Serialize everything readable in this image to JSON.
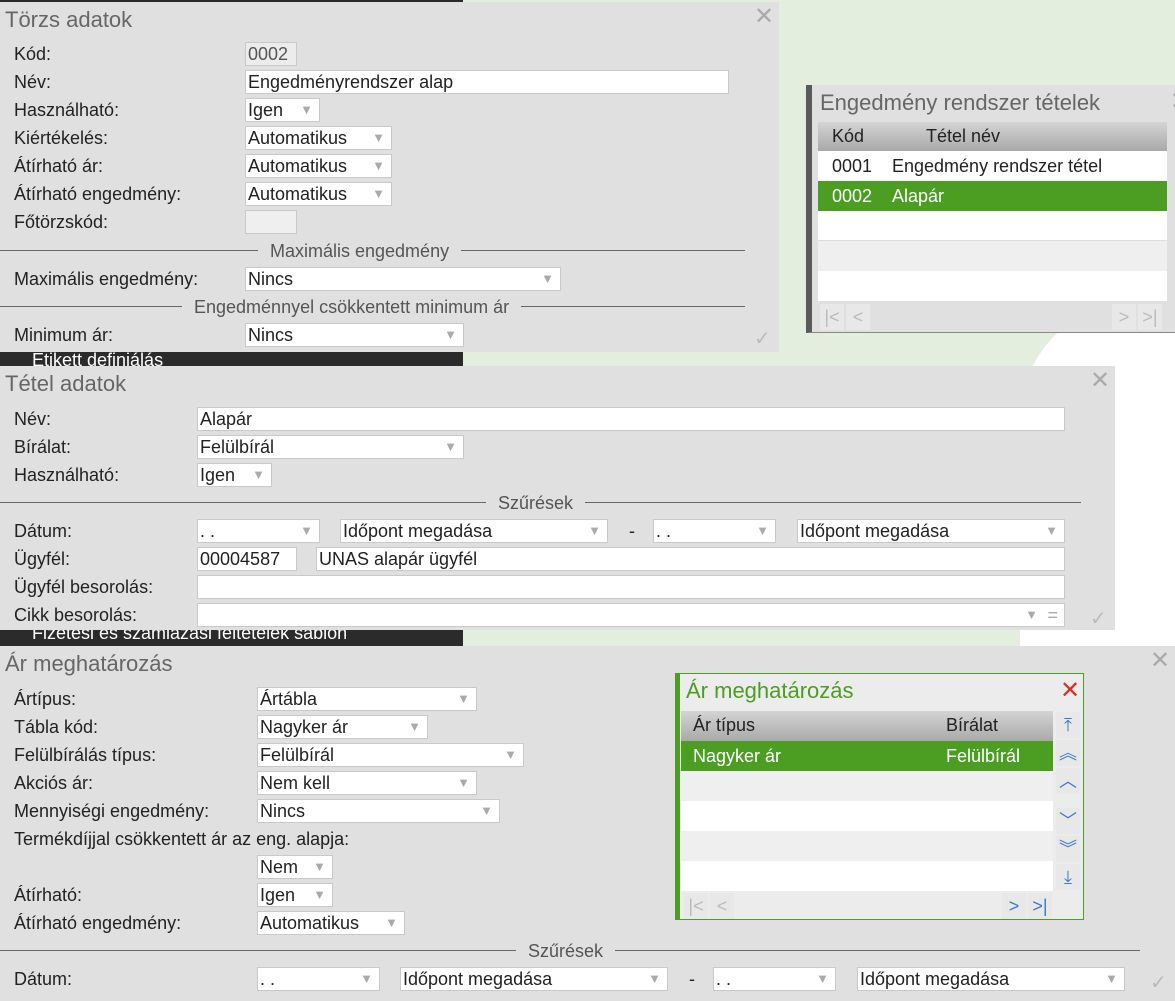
{
  "background": {
    "bar1": "Etikett definiálás",
    "bar2": "Fizetési és számlázási feltételek sablon"
  },
  "torzs": {
    "title": "Törzs adatok",
    "kod_label": "Kód:",
    "kod": "0002",
    "nev_label": "Név:",
    "nev": "Engedményrendszer alap",
    "hasznalhato_label": "Használható:",
    "hasznalhato": "Igen",
    "kiertekeles_label": "Kiértékelés:",
    "kiertekeles": "Automatikus",
    "atirhato_ar_label": "Átírható ár:",
    "atirhato_ar": "Automatikus",
    "atirhato_eng_label": "Átírható engedmény:",
    "atirhato_eng": "Automatikus",
    "fotorzskod_label": "Főtörzskód:",
    "fotorzskod": "",
    "sep1": "Maximális engedmény",
    "max_eng_label": "Maximális engedmény:",
    "max_eng": "Nincs",
    "sep2": "Engedménnyel csökkentett minimum ár",
    "min_ar_label": "Minimum ár:",
    "min_ar": "Nincs"
  },
  "tetelek": {
    "title": "Engedmény rendszer tételek",
    "columns": [
      "Kód",
      "Tétel név"
    ],
    "rows": [
      {
        "kod": "0001",
        "nev": "Engedmény rendszer tétel"
      },
      {
        "kod": "0002",
        "nev": "Alapár"
      }
    ]
  },
  "tetel": {
    "title": "Tétel adatok",
    "nev_label": "Név:",
    "nev": "Alapár",
    "biralat_label": "Bírálat:",
    "biralat": "Felülbírál",
    "hasznalhato_label": "Használható:",
    "hasznalhato": "Igen",
    "sep": "Szűrések",
    "datum_label": "Dátum:",
    "datum_from": ". .",
    "idopont_from": "Időpont megadása",
    "dash": "-",
    "datum_to": ". .",
    "idopont_to": "Időpont megadása",
    "ugyfel_label": "Ügyfél:",
    "ugyfel_kod": "00004587",
    "ugyfel_nev": "UNAS alapár ügyfél",
    "ugyfel_bes_label": "Ügyfél besorolás:",
    "ugyfel_bes": "",
    "cikk_bes_label": "Cikk besorolás:",
    "cikk_bes": ""
  },
  "ar": {
    "title": "Ár meghatározás",
    "artipus_label": "Ártípus:",
    "artipus": "Ártábla",
    "tabla_label": "Tábla kód:",
    "tabla": "Nagyker ár",
    "felulb_label": "Felülbírálás típus:",
    "felulb": "Felülbírál",
    "akcios_label": "Akciós ár:",
    "akcios": "Nem kell",
    "menny_label": "Mennyiségi engedmény:",
    "menny": "Nincs",
    "termekdij_label": "Termékdíjjal csökkentett ár az eng. alapja:",
    "termekdij": "Nem",
    "atirhato_label": "Átírható:",
    "atirhato": "Igen",
    "atirhato_eng_label": "Átírható engedmény:",
    "atirhato_eng": "Automatikus",
    "sep": "Szűrések",
    "datum_label": "Dátum:",
    "datum_from": ". .",
    "idopont_from": "Időpont megadása",
    "dash": "-",
    "datum_to": ". .",
    "idopont_to": "Időpont megadása",
    "list": {
      "title": "Ár meghatározás",
      "columns": [
        "Ár típus",
        "Bírálat"
      ],
      "rows": [
        {
          "tipus": "Nagyker ár",
          "biralat": "Felülbírál"
        }
      ]
    }
  },
  "colors": {
    "accent": "#4b9e22",
    "close_red": "#d9302a",
    "nav_blue": "#3a7bc8"
  }
}
